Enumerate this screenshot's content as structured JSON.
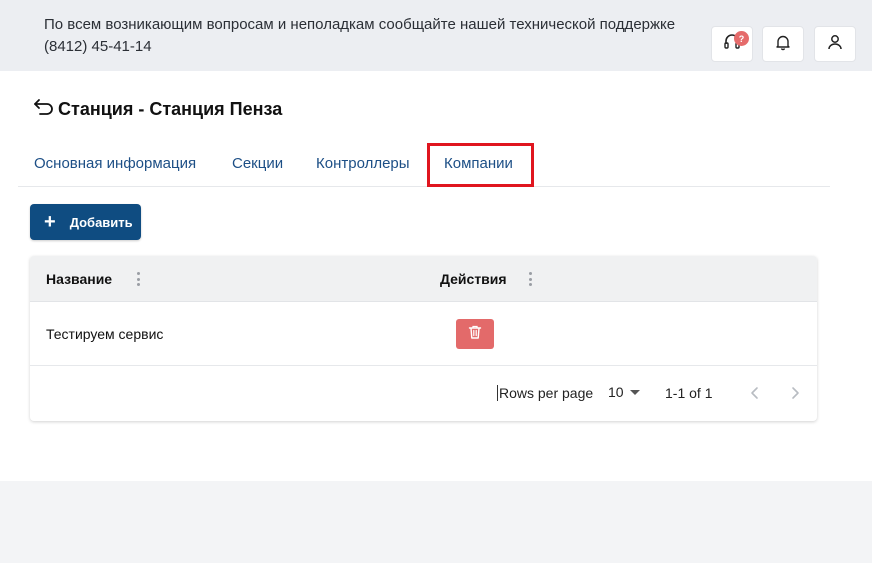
{
  "header": {
    "support_line1": "По всем возникающим вопросам и неполадкам сообщайте нашей технической поддержке",
    "support_phone": "(8412) 45-41-14",
    "support_badge": "?"
  },
  "page": {
    "title": "Станция - Станция Пенза"
  },
  "tabs": [
    {
      "label": "Основная информация"
    },
    {
      "label": "Секции"
    },
    {
      "label": "Контроллеры"
    },
    {
      "label": "Компании"
    }
  ],
  "active_tab": "Компании",
  "toolbar": {
    "add_label": "Добавить"
  },
  "table": {
    "columns": [
      "Название",
      "Действия"
    ],
    "rows": [
      {
        "name": "Тестируем сервис"
      }
    ]
  },
  "pagination": {
    "rows_per_page_label": "Rows per page",
    "rows_per_page_value": "10",
    "range": "1-1 of 1"
  },
  "colors": {
    "primary": "#0f4c81",
    "danger": "#e36a6a",
    "highlight": "#e0151f",
    "tab_text": "#1d4f86"
  }
}
